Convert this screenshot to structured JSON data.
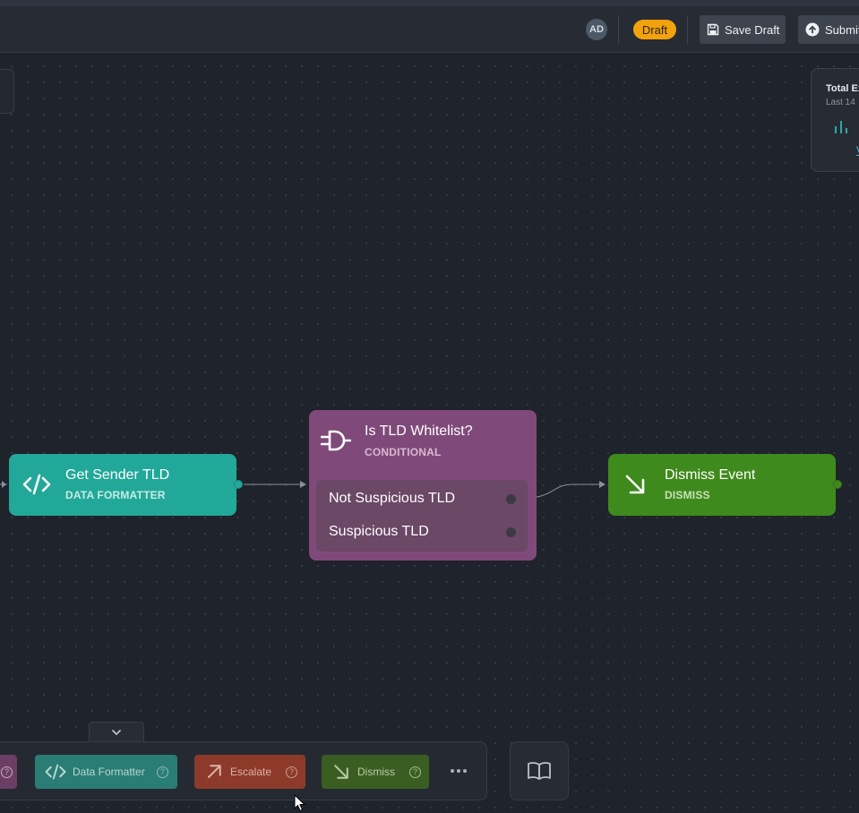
{
  "toolbar": {
    "avatar_initials": "AD",
    "status_badge": "Draft",
    "save_label": "Save Draft",
    "submit_label": "Submit"
  },
  "stats": {
    "title": "Total Ex",
    "subtitle": "Last 14",
    "link": "V"
  },
  "nodes": {
    "get_sender_tld": {
      "title": "Get Sender TLD",
      "type": "DATA FORMATTER",
      "color": "#22a899",
      "icon": "code-icon"
    },
    "is_tld_whitelist": {
      "title": "Is TLD Whitelist?",
      "type": "CONDITIONAL",
      "color": "#7f4a79",
      "icon": "plug-icon",
      "branches": [
        "Not Suspicious TLD",
        "Suspicious TLD"
      ]
    },
    "dismiss_event": {
      "title": "Dismiss Event",
      "type": "DISMISS",
      "color": "#3f8a1d",
      "icon": "arrow-down-right-icon"
    }
  },
  "palette": {
    "items": [
      {
        "label": "Data Formatter",
        "color": "#2a7d74",
        "icon": "code-icon"
      },
      {
        "label": "Escalate",
        "color": "#8d3a2a",
        "icon": "arrow-up-right-icon"
      },
      {
        "label": "Dismiss",
        "color": "#3a5e22",
        "icon": "arrow-down-right-icon"
      }
    ],
    "more_icon": "ellipsis-icon",
    "docs_icon": "book-icon"
  }
}
